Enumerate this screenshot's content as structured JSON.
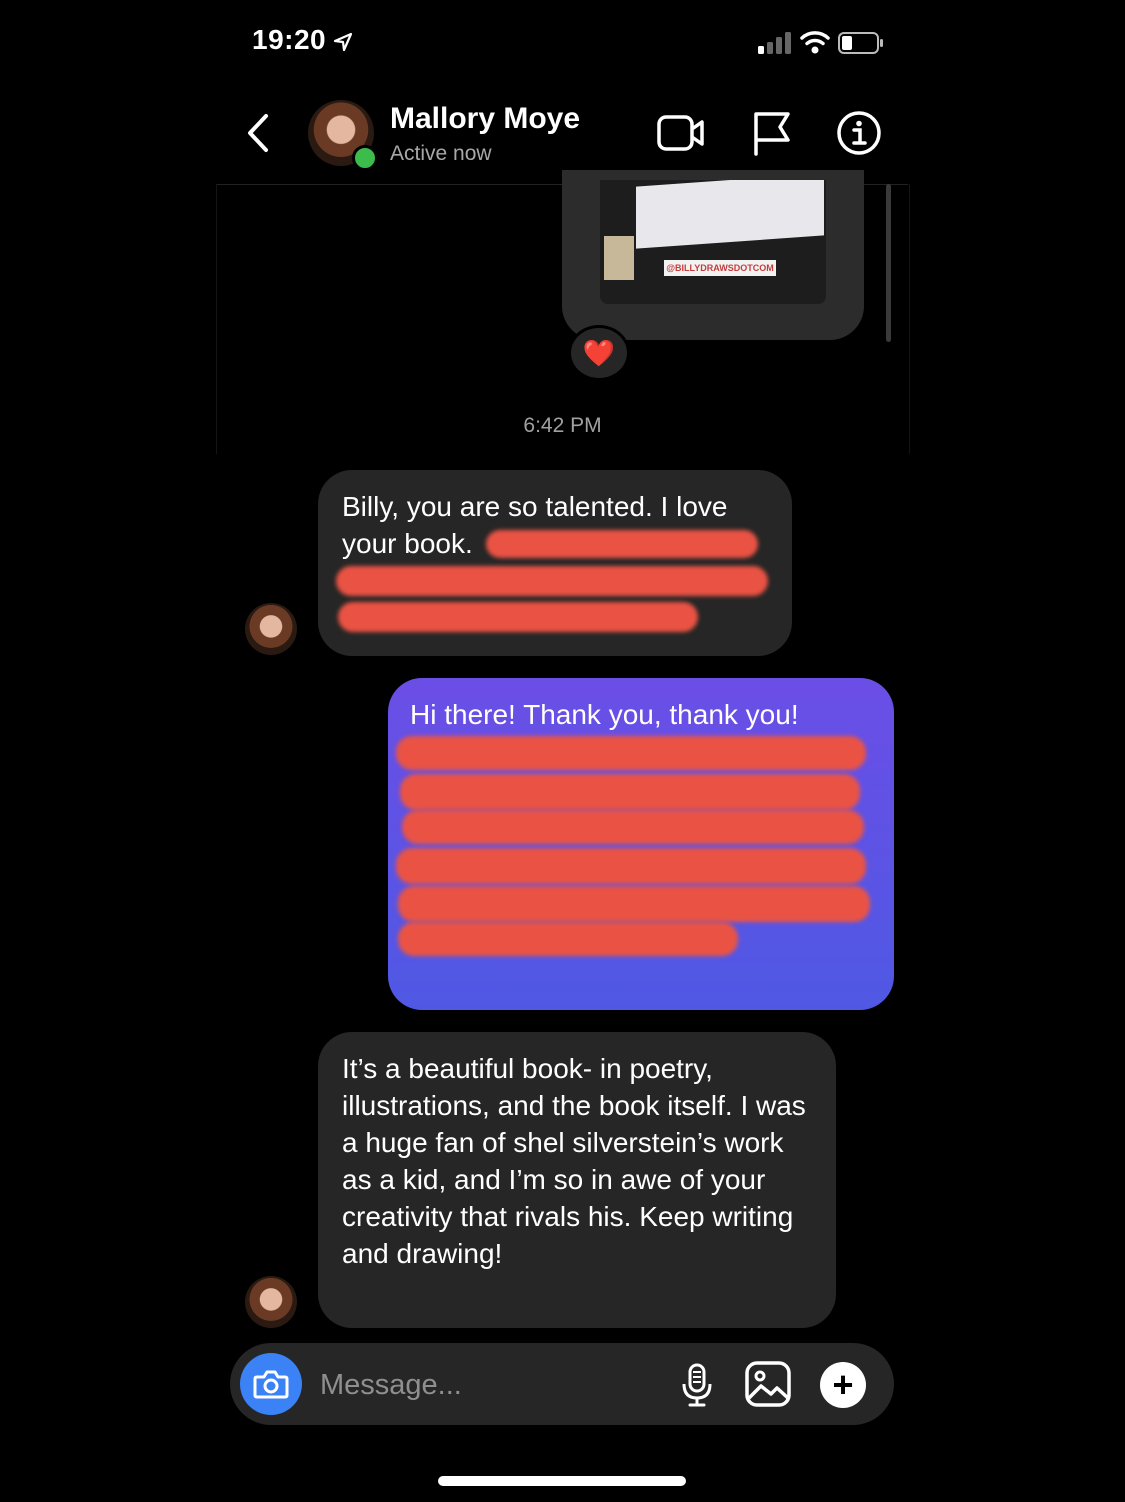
{
  "status_bar": {
    "time": "19:20"
  },
  "header": {
    "contact_name": "Mallory Moye",
    "contact_status": "Active now"
  },
  "story": {
    "tag_text": "@BILLYDRAWSDOTCOM",
    "reaction": "❤️"
  },
  "thread": {
    "timestamp": "6:42 PM",
    "messages": [
      {
        "from": "contact",
        "text": "Billy, you are so talented. I love your book."
      },
      {
        "from": "me",
        "text": "Hi there! Thank you, thank you!"
      },
      {
        "from": "contact",
        "text": "It’s a beautiful book- in poetry, illustrations, and the book itself. I was a huge fan of shel silverstein’s work as a kid, and I’m so in awe of your creativity that rivals his. Keep writing and drawing!"
      }
    ]
  },
  "composer": {
    "placeholder": "Message...",
    "plus_label": "+"
  },
  "colors": {
    "accent_blue": "#3b82f6",
    "sent_bubble_top": "#6b4ee6",
    "sent_bubble_bottom": "#4f58e4",
    "received_bubble": "#262626",
    "redaction": "#ea5344",
    "online": "#3cbd4b"
  }
}
